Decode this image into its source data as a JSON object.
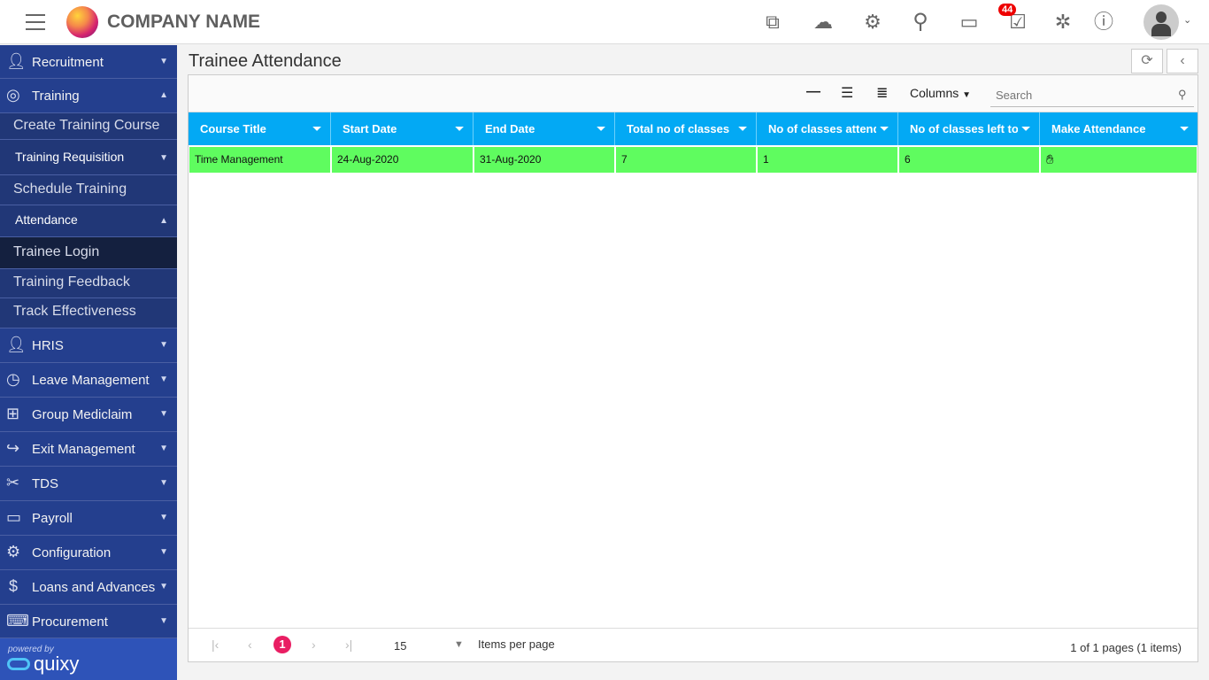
{
  "header": {
    "company": "COMPANY NAME",
    "notification_count": "44",
    "icons": [
      "add-layer-icon",
      "cloud-download-icon",
      "user-settings-icon",
      "search-icon",
      "chat-icon",
      "tasks-icon",
      "bug-icon",
      "info-icon"
    ]
  },
  "sidebar": {
    "items": [
      {
        "label": "Recruitment",
        "icon": "user-icon"
      },
      {
        "label": "Training",
        "icon": "target-icon"
      },
      {
        "label": "Create Training Course"
      },
      {
        "label": "Training Requisition"
      },
      {
        "label": "Schedule Training"
      },
      {
        "label": "Attendance"
      },
      {
        "label": "Trainee Login"
      },
      {
        "label": "Training Feedback"
      },
      {
        "label": "Track Effectiveness"
      },
      {
        "label": "HRIS",
        "icon": "user-icon"
      },
      {
        "label": "Leave Management",
        "icon": "clock-icon"
      },
      {
        "label": "Group Mediclaim",
        "icon": "medical-icon"
      },
      {
        "label": "Exit Management",
        "icon": "share-icon"
      },
      {
        "label": "TDS",
        "icon": "scissors-icon"
      },
      {
        "label": "Payroll",
        "icon": "money-icon"
      },
      {
        "label": "Configuration",
        "icon": "gear-icon"
      },
      {
        "label": "Loans and Advances",
        "icon": "dollar-icon"
      },
      {
        "label": "Procurement",
        "icon": "laptop-icon"
      }
    ],
    "powered_by": "powered by",
    "brand": "quixy"
  },
  "page": {
    "title": "Trainee Attendance"
  },
  "toolbar": {
    "columns": "Columns",
    "search_placeholder": "Search"
  },
  "table": {
    "columns": [
      "Course Title",
      "Start Date",
      "End Date",
      "Total no of classes",
      "No of classes attended",
      "No of classes left to attend",
      "Make Attendance"
    ],
    "rows": [
      [
        "Time Management",
        "24-Aug-2020",
        "31-Aug-2020",
        "7",
        "1",
        "6"
      ]
    ],
    "row_color": "#5ffc5f",
    "header_color": "#03a9f4"
  },
  "pager": {
    "current": "1",
    "page_size": "15",
    "items_per_page": "Items per page",
    "summary": "1 of 1 pages (1 items)"
  }
}
